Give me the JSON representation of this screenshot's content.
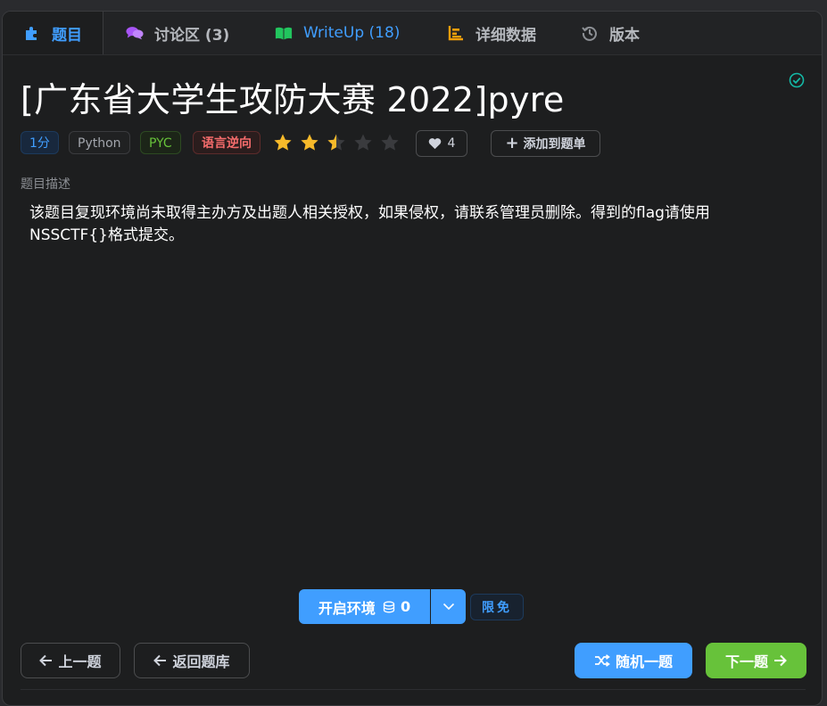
{
  "tabs": [
    {
      "label": "题目",
      "icon": "puzzle-icon",
      "active": true
    },
    {
      "label": "讨论区 (3)",
      "icon": "comments-icon"
    },
    {
      "label": "WriteUp (18)",
      "icon": "book-open-icon"
    },
    {
      "label": "详细数据",
      "icon": "bar-chart-icon"
    },
    {
      "label": "版本",
      "icon": "history-icon"
    }
  ],
  "problem": {
    "title": "[广东省大学生攻防大赛 2022]pyre",
    "solved_icon": "check-circle-icon",
    "tags": {
      "score": "1分",
      "lang": "Python",
      "type": "PYC",
      "category": "语言逆向"
    },
    "rating": 2.5,
    "rating_max": 5,
    "likes": "4",
    "add_to_list": "添加到题单",
    "description_label": "题目描述",
    "description": "该题目复现环境尚未取得主办方及出题人相关授权，如果侵权，请联系管理员删除。得到的flag请使用NSSCTF{}格式提交。"
  },
  "env": {
    "start_label": "开启环境",
    "coin_count": "0",
    "free_tag": "限免"
  },
  "nav": {
    "prev": "上一题",
    "back": "返回题库",
    "random": "随机一题",
    "next": "下一题"
  },
  "colors": {
    "accent": "#409eff",
    "success": "#67c23a",
    "danger": "#f56c6c",
    "star": "#f7ba2a",
    "background": "#1d1e1f"
  }
}
